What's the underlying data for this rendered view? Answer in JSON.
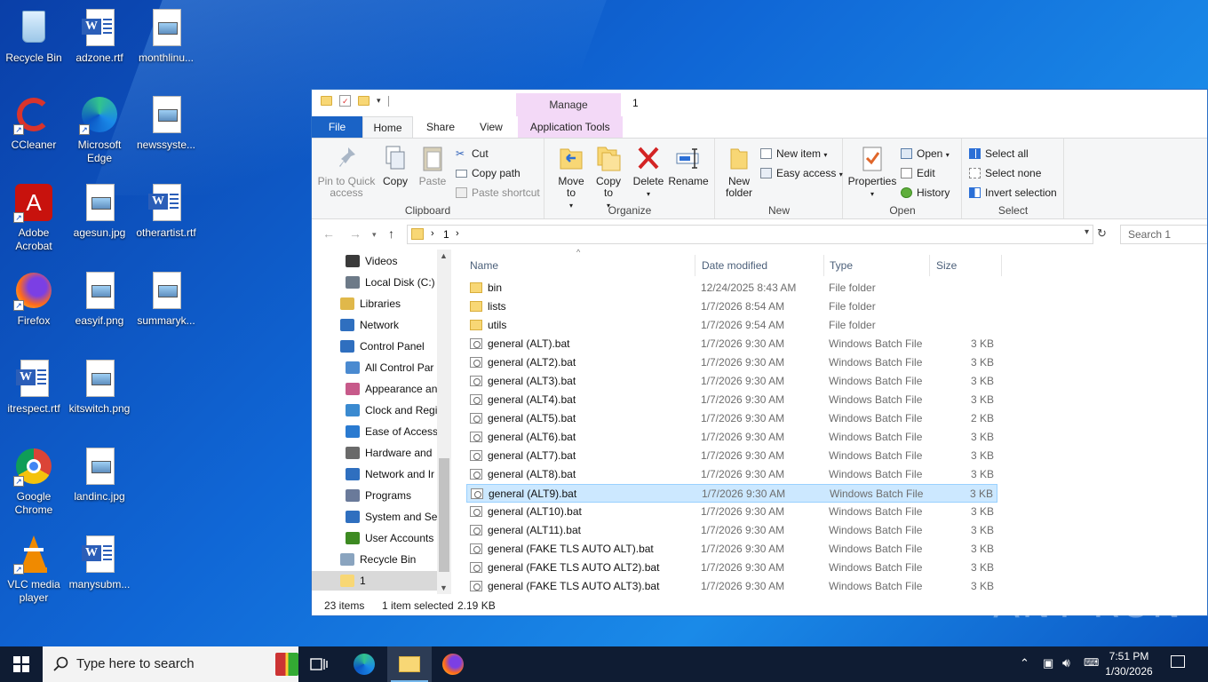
{
  "desktop": {
    "icons": [
      {
        "label": "Recycle Bin",
        "icon": "recycle-bin-icon"
      },
      {
        "label": "adzone.rtf",
        "icon": "word-document-icon"
      },
      {
        "label": "monthlinu...",
        "icon": "image-file-icon"
      },
      {
        "label": "CCleaner",
        "icon": "ccleaner-icon"
      },
      {
        "label": "Microsoft Edge",
        "icon": "edge-icon"
      },
      {
        "label": "newssyste...",
        "icon": "image-file-icon"
      },
      {
        "label": "Adobe Acrobat",
        "icon": "acrobat-icon"
      },
      {
        "label": "agesun.jpg",
        "icon": "image-file-icon"
      },
      {
        "label": "otherartist.rtf",
        "icon": "word-document-icon"
      },
      {
        "label": "Firefox",
        "icon": "firefox-icon"
      },
      {
        "label": "easyif.png",
        "icon": "image-file-icon"
      },
      {
        "label": "summaryk...",
        "icon": "image-file-icon"
      },
      {
        "label": "itrespect.rtf",
        "icon": "word-document-icon"
      },
      {
        "label": "kitswitch.png",
        "icon": "image-file-icon"
      },
      {
        "label": "Google Chrome",
        "icon": "chrome-icon"
      },
      {
        "label": "landinc.jpg",
        "icon": "image-file-icon"
      },
      {
        "label": "VLC media player",
        "icon": "vlc-icon"
      },
      {
        "label": "manysubm...",
        "icon": "word-document-icon"
      }
    ]
  },
  "explorer": {
    "title": "1",
    "manage_tab": "Manage",
    "tabs": {
      "file": "File",
      "home": "Home",
      "share": "Share",
      "view": "View",
      "app_tools": "Application Tools"
    },
    "ribbon": {
      "clipboard": {
        "label": "Clipboard",
        "pin": "Pin to Quick access",
        "copy": "Copy",
        "paste": "Paste",
        "cut": "Cut",
        "copy_path": "Copy path",
        "paste_shortcut": "Paste shortcut"
      },
      "organize": {
        "label": "Organize",
        "move_to": "Move to",
        "copy_to": "Copy to",
        "delete": "Delete",
        "rename": "Rename"
      },
      "new": {
        "label": "New",
        "new_folder": "New folder",
        "new_item": "New item",
        "easy_access": "Easy access"
      },
      "open": {
        "label": "Open",
        "properties": "Properties",
        "open": "Open",
        "edit": "Edit",
        "history": "History"
      },
      "select": {
        "label": "Select",
        "select_all": "Select all",
        "select_none": "Select none",
        "invert": "Invert selection"
      }
    },
    "address": {
      "path": "1",
      "search_placeholder": "Search 1"
    },
    "nav_pane": [
      {
        "label": "Videos",
        "indent": 1
      },
      {
        "label": "Local Disk (C:)",
        "indent": 1
      },
      {
        "label": "Libraries",
        "indent": 0
      },
      {
        "label": "Network",
        "indent": 0
      },
      {
        "label": "Control Panel",
        "indent": 0
      },
      {
        "label": "All Control Par",
        "indent": 1
      },
      {
        "label": "Appearance an",
        "indent": 1
      },
      {
        "label": "Clock and Regi",
        "indent": 1
      },
      {
        "label": "Ease of Access",
        "indent": 1
      },
      {
        "label": "Hardware and",
        "indent": 1
      },
      {
        "label": "Network and Ir",
        "indent": 1
      },
      {
        "label": "Programs",
        "indent": 1
      },
      {
        "label": "System and Sec",
        "indent": 1
      },
      {
        "label": "User Accounts",
        "indent": 1
      },
      {
        "label": "Recycle Bin",
        "indent": 0
      },
      {
        "label": "1",
        "indent": 0
      }
    ],
    "columns": {
      "name": "Name",
      "date": "Date modified",
      "type": "Type",
      "size": "Size"
    },
    "files": [
      {
        "name": "bin",
        "date": "12/24/2025 8:43 AM",
        "type": "File folder",
        "size": "",
        "kind": "folder"
      },
      {
        "name": "lists",
        "date": "1/7/2026 8:54 AM",
        "type": "File folder",
        "size": "",
        "kind": "folder"
      },
      {
        "name": "utils",
        "date": "1/7/2026 9:54 AM",
        "type": "File folder",
        "size": "",
        "kind": "folder"
      },
      {
        "name": "general (ALT).bat",
        "date": "1/7/2026 9:30 AM",
        "type": "Windows Batch File",
        "size": "3 KB",
        "kind": "bat"
      },
      {
        "name": "general (ALT2).bat",
        "date": "1/7/2026 9:30 AM",
        "type": "Windows Batch File",
        "size": "3 KB",
        "kind": "bat"
      },
      {
        "name": "general (ALT3).bat",
        "date": "1/7/2026 9:30 AM",
        "type": "Windows Batch File",
        "size": "3 KB",
        "kind": "bat"
      },
      {
        "name": "general (ALT4).bat",
        "date": "1/7/2026 9:30 AM",
        "type": "Windows Batch File",
        "size": "3 KB",
        "kind": "bat"
      },
      {
        "name": "general (ALT5).bat",
        "date": "1/7/2026 9:30 AM",
        "type": "Windows Batch File",
        "size": "2 KB",
        "kind": "bat"
      },
      {
        "name": "general (ALT6).bat",
        "date": "1/7/2026 9:30 AM",
        "type": "Windows Batch File",
        "size": "3 KB",
        "kind": "bat"
      },
      {
        "name": "general (ALT7).bat",
        "date": "1/7/2026 9:30 AM",
        "type": "Windows Batch File",
        "size": "3 KB",
        "kind": "bat"
      },
      {
        "name": "general (ALT8).bat",
        "date": "1/7/2026 9:30 AM",
        "type": "Windows Batch File",
        "size": "3 KB",
        "kind": "bat"
      },
      {
        "name": "general (ALT9).bat",
        "date": "1/7/2026 9:30 AM",
        "type": "Windows Batch File",
        "size": "3 KB",
        "kind": "bat",
        "selected": true
      },
      {
        "name": "general (ALT10).bat",
        "date": "1/7/2026 9:30 AM",
        "type": "Windows Batch File",
        "size": "3 KB",
        "kind": "bat"
      },
      {
        "name": "general (ALT11).bat",
        "date": "1/7/2026 9:30 AM",
        "type": "Windows Batch File",
        "size": "3 KB",
        "kind": "bat"
      },
      {
        "name": "general (FAKE TLS AUTO ALT).bat",
        "date": "1/7/2026 9:30 AM",
        "type": "Windows Batch File",
        "size": "3 KB",
        "kind": "bat"
      },
      {
        "name": "general (FAKE TLS AUTO ALT2).bat",
        "date": "1/7/2026 9:30 AM",
        "type": "Windows Batch File",
        "size": "3 KB",
        "kind": "bat"
      },
      {
        "name": "general (FAKE TLS AUTO ALT3).bat",
        "date": "1/7/2026 9:30 AM",
        "type": "Windows Batch File",
        "size": "3 KB",
        "kind": "bat"
      }
    ],
    "status": {
      "items": "23 items",
      "selected": "1 item selected",
      "size": "2.19 KB"
    }
  },
  "taskbar": {
    "search_placeholder": "Type here to search",
    "time": "7:51 PM",
    "date": "1/30/2026"
  },
  "watermark": "ANY RUN"
}
